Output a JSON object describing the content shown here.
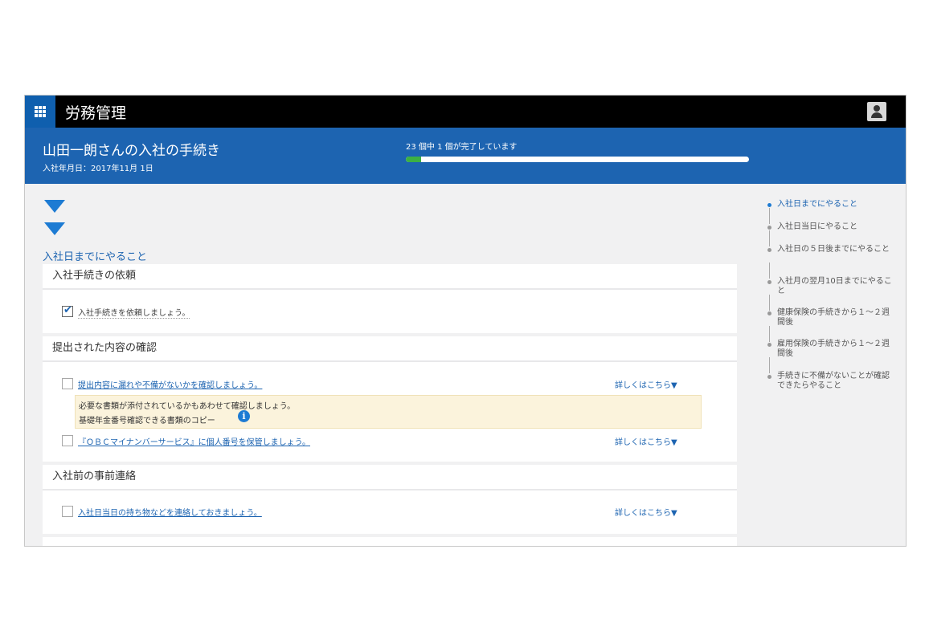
{
  "app": {
    "title": "労務管理"
  },
  "header": {
    "title": "山田一朗さんの入社の手続き",
    "subtitle": "入社年月日：2017年11月 1日",
    "progress_text": "23 個中 1 個が完了しています",
    "progress": {
      "completed": 1,
      "total": 23
    }
  },
  "section": {
    "title": "入社日までにやること"
  },
  "cards": [
    {
      "title": "入社手続きの依頼",
      "tasks": [
        {
          "label": "入社手続きを依頼しましょう。",
          "checked": true
        }
      ]
    },
    {
      "title": "提出された内容の確認",
      "tasks": [
        {
          "label": "提出内容に漏れや不備がないかを確認しましょう。",
          "checked": false,
          "detail": "詳しくはこちら▼"
        },
        {
          "label": "『ＯＢＣマイナンバーサービス』に個人番号を保管しましょう。",
          "checked": false,
          "detail": "詳しくはこちら▼"
        }
      ],
      "note": {
        "line1": "必要な書類が添付されているかもあわせて確認しましょう。",
        "line2": "基礎年金番号確認できる書類のコピー"
      }
    },
    {
      "title": "入社前の事前連絡",
      "tasks": [
        {
          "label": "入社日当日の持ち物などを連絡しておきましょう。",
          "checked": false,
          "detail": "詳しくはこちら▼"
        }
      ]
    }
  ],
  "timeline": [
    {
      "label": "入社日までにやること",
      "active": true
    },
    {
      "label": "入社日当日にやること",
      "active": false
    },
    {
      "label": "入社日の５日後までにやること",
      "active": false
    },
    {
      "label": "入社月の翌月10日までにやること",
      "active": false
    },
    {
      "label": "健康保険の手続きから１～２週間後",
      "active": false
    },
    {
      "label": "雇用保険の手続きから１～２週間後",
      "active": false
    },
    {
      "label": "手続きに不備がないことが確認できたらやること",
      "active": false
    }
  ],
  "colors": {
    "header_bg": "#1d64b1",
    "topbar_bg": "#000000",
    "accent": "#1d7bd3",
    "progress": "#3cb043",
    "note_bg": "#fbf3dc"
  },
  "icons": [
    "app-launcher-grid-icon",
    "user-avatar-icon",
    "collapse-arrow-icon",
    "checkbox-checked-icon",
    "info-icon"
  ]
}
